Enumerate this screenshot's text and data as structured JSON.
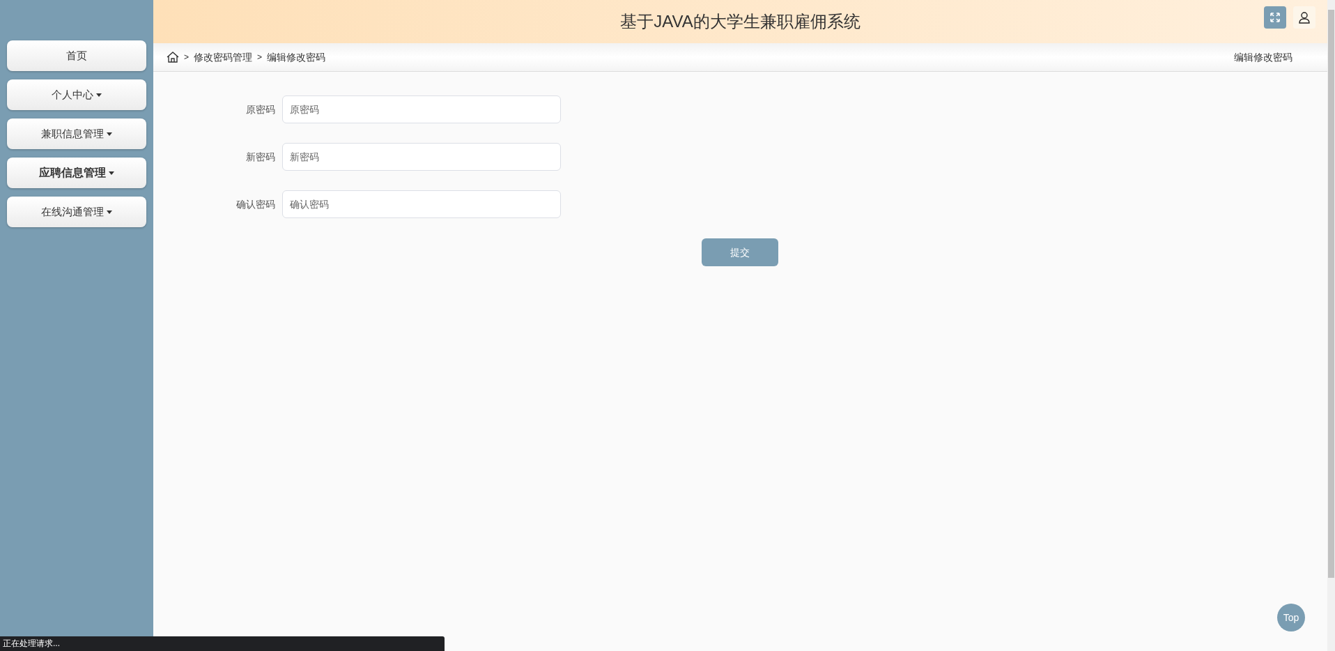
{
  "header": {
    "title": "基于JAVA的大学生兼职雇佣系统"
  },
  "sidebar": {
    "items": [
      {
        "label": "首页",
        "kind": "link",
        "selected": false
      },
      {
        "label": "个人中心",
        "kind": "dropdown",
        "selected": false
      },
      {
        "label": "兼职信息管理",
        "kind": "dropdown",
        "selected": false
      },
      {
        "label": "应聘信息管理",
        "kind": "dropdown",
        "selected": true
      },
      {
        "label": "在线沟通管理",
        "kind": "dropdown",
        "selected": false
      }
    ]
  },
  "breadcrumb": {
    "items": [
      {
        "separator": ">",
        "label": "修改密码管理"
      },
      {
        "separator": ">",
        "label": "编辑修改密码"
      }
    ],
    "page_title": "编辑修改密码"
  },
  "form": {
    "fields": [
      {
        "label": "原密码",
        "placeholder": "原密码"
      },
      {
        "label": "新密码",
        "placeholder": "新密码"
      },
      {
        "label": "确认密码",
        "placeholder": "确认密码"
      }
    ],
    "submit": "提交"
  },
  "top_button": "Top",
  "status_bar": "正在处理请求..."
}
